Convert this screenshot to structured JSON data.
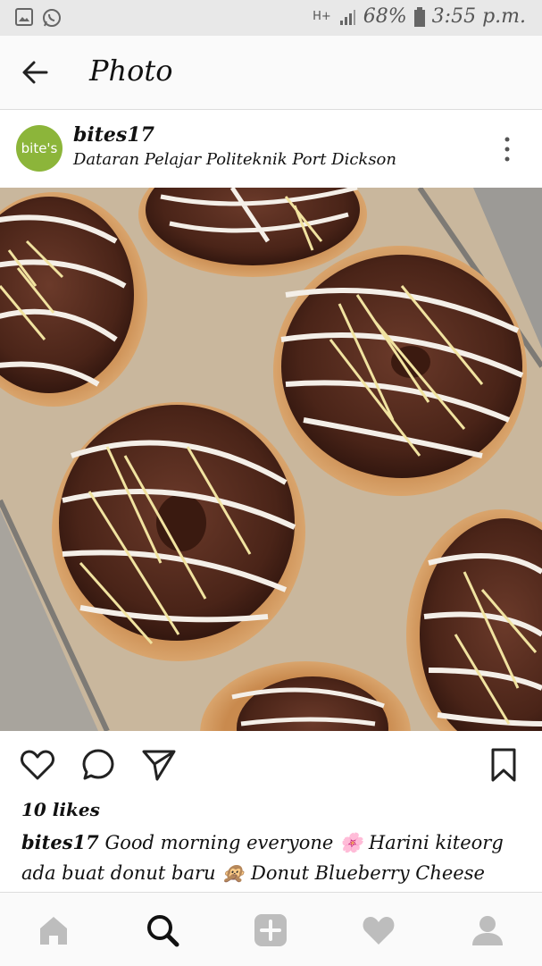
{
  "status_bar": {
    "network": "H+",
    "battery_percent": "68%",
    "time": "3:55 p.m."
  },
  "app_bar": {
    "title": "Photo"
  },
  "post": {
    "username": "bites17",
    "location": "Dataran Pelajar Politeknik Port Dickson",
    "avatar_text": "bite's",
    "likes": "10 likes",
    "caption_user": "bites17",
    "caption_text": "Good morning everyone 🌸 Harini kiteorg ada buat donut baru 🙊 Donut Blueberry Cheese"
  },
  "icons": {
    "back": "back-arrow-icon",
    "more": "more-vertical-icon",
    "like": "heart-icon",
    "comment": "comment-icon",
    "share": "send-icon",
    "save": "bookmark-icon",
    "nav": [
      "home-icon",
      "search-icon",
      "add-icon",
      "activity-heart-icon",
      "profile-icon"
    ]
  },
  "colors": {
    "avatar_green": "#8cb53a",
    "status_bar": "#e8e8e8",
    "nav_inactive": "#bdbdbd"
  }
}
